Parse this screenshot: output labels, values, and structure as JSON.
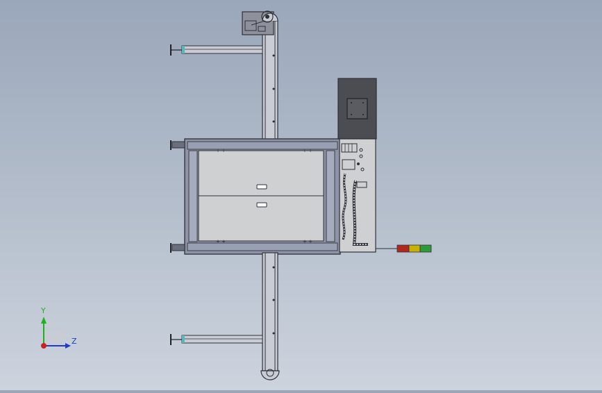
{
  "app": {
    "view": "CAD model viewport - top view of conveyor machine"
  },
  "triad": {
    "y_label": "Y",
    "z_label": "Z",
    "y_color": "#22b022",
    "z_color": "#1c3ccc",
    "x_color": "#cc2222"
  },
  "colors": {
    "frame": "#8e93a6",
    "frame_dark": "#3a3d48",
    "panel": "#cfd0d2",
    "cabinet": "#4b4d53",
    "rail": "#c9ccd4",
    "rail_edge": "#2e3038",
    "tower_red": "#b3261e",
    "tower_yellow": "#c7b200",
    "tower_green": "#2e9a3a"
  },
  "icons": [
    "motor-icon",
    "control-cabinet-icon",
    "signal-tower-icon",
    "axis-triad-icon"
  ]
}
